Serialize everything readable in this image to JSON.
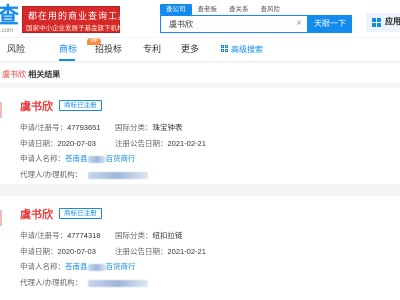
{
  "header": {
    "logo_char": "查",
    "logo_sub": ".com",
    "banner_line1": "都在用的商业查询工具",
    "banner_line2": "国家中小企业发展子基金旗下机构",
    "search_tabs": [
      "查公司",
      "查老板",
      "查关系",
      "查风险"
    ],
    "search_value": "虞书欣",
    "search_button": "天眼一下",
    "app_label": "应用"
  },
  "nav": {
    "items": [
      "风险",
      "商标",
      "招投标",
      "专利",
      "更多"
    ],
    "advanced": "高级搜索",
    "vip_badge": "VIP"
  },
  "results": {
    "keyword": "虞书欣",
    "suffix": " 相关结果"
  },
  "cards": [
    {
      "title": "虞书欣",
      "status": "商标已注册",
      "reg_label": "申请/注册号：",
      "reg_no": "47793651",
      "class_label": "国际分类：",
      "class_val": "珠宝钟表",
      "apply_label": "申请日期：",
      "apply_date": "2020-07-03",
      "pub_label": "注册公告日期：",
      "pub_date": "2021-02-21",
      "applicant_label": "申请人名称：",
      "applicant_a": "苍南县",
      "applicant_b": "百货商行",
      "agent_label": "代理人/办理机构："
    },
    {
      "title": "虞书欣",
      "status": "商标已注册",
      "reg_label": "申请/注册号：",
      "reg_no": "47774318",
      "class_label": "国际分类：",
      "class_val": "纽扣拉链",
      "apply_label": "申请日期：",
      "apply_date": "2020-07-03",
      "pub_label": "注册公告日期：",
      "pub_date": "2021-02-21",
      "applicant_label": "申请人名称：",
      "applicant_a": "苍南县",
      "applicant_b": "百货商行",
      "agent_label": "代理人/办理机构："
    }
  ],
  "colors": {
    "accent": "#128bed",
    "highlight": "#ee3a3a",
    "banner": "#d62a2a"
  }
}
